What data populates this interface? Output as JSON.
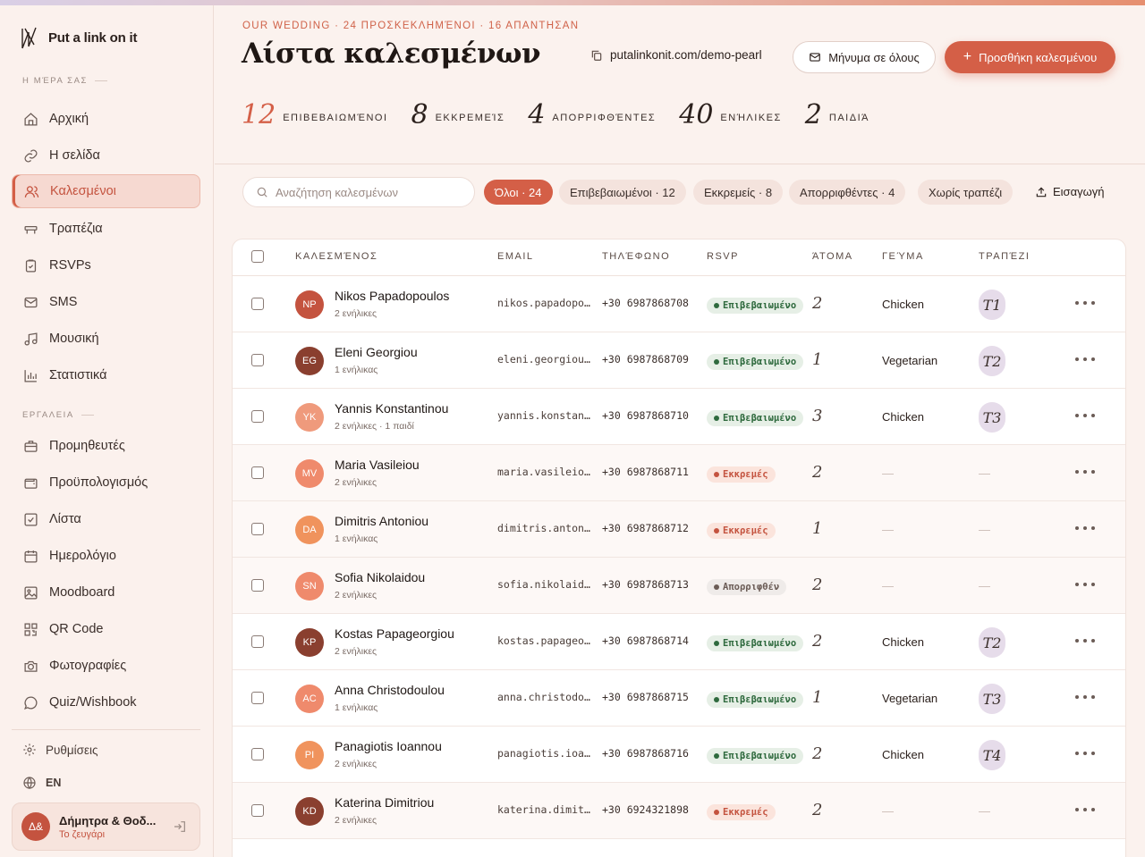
{
  "brand": {
    "name": "Put a link on it"
  },
  "sidebar": {
    "section_day": "Η ΜΈΡΑ ΣΑΣ",
    "section_tools": "ΕΡΓΑΛΕΙΑ",
    "items": [
      {
        "label": "Αρχική",
        "icon": "home-icon"
      },
      {
        "label": "Η σελίδα",
        "icon": "link-icon"
      },
      {
        "label": "Καλεσμένοι",
        "icon": "users-icon"
      },
      {
        "label": "Τραπέζια",
        "icon": "table-icon"
      },
      {
        "label": "RSVPs",
        "icon": "clipboard-icon"
      },
      {
        "label": "SMS",
        "icon": "mail-icon"
      },
      {
        "label": "Μουσική",
        "icon": "music-icon"
      },
      {
        "label": "Στατιστικά",
        "icon": "chart-icon"
      }
    ],
    "tools": [
      {
        "label": "Προμηθευτές",
        "icon": "briefcase-icon"
      },
      {
        "label": "Προϋπολογισμός",
        "icon": "wallet-icon"
      },
      {
        "label": "Λίστα",
        "icon": "checklist-icon"
      },
      {
        "label": "Ημερολόγιο",
        "icon": "calendar-icon"
      },
      {
        "label": "Moodboard",
        "icon": "image-icon"
      },
      {
        "label": "QR Code",
        "icon": "qr-icon"
      },
      {
        "label": "Φωτογραφίες",
        "icon": "camera-icon"
      },
      {
        "label": "Quiz/Wishbook",
        "icon": "chat-icon"
      }
    ],
    "settings_label": "Ρυθμίσεις",
    "language_label": "EN",
    "user": {
      "initials": "Δ&",
      "name": "Δήμητρα & Θοδ...",
      "role": "Το ζευγάρι"
    }
  },
  "header": {
    "kicker": "OUR WEDDING · 24 ΠΡΟΣΚΕΚΛΗΜΈΝΟΙ · 16 ΑΠΑΝΤΗΣΑΝ",
    "title": "Λίστα καλεσμένων",
    "site_link": "putalinkonit.com/demo-pearl",
    "message_all": "Μήνυμα σε όλους",
    "add_guest": "Προσθήκη καλεσμένου"
  },
  "stats": [
    {
      "value": "12",
      "label": "ΕΠΙΒΕΒΑΙΩΜΈΝΟΙ"
    },
    {
      "value": "8",
      "label": "ΕΚΚΡΕΜΕΊΣ"
    },
    {
      "value": "4",
      "label": "ΑΠΟΡΡΙΦΘΈΝΤΕΣ"
    },
    {
      "value": "40",
      "label": "ΕΝΉΛΙΚΕΣ"
    },
    {
      "value": "2",
      "label": "ΠΑΙΔΙΆ"
    }
  ],
  "filters": {
    "search_placeholder": "Αναζήτηση καλεσμένων",
    "chips": [
      "Όλοι · 24",
      "Επιβεβαιωμένοι · 12",
      "Εκκρεμείς · 8",
      "Απορριφθέντες · 4",
      "Χωρίς τραπέζι"
    ],
    "import_label": "Εισαγωγή"
  },
  "table": {
    "columns": [
      "ΚΑΛΕΣΜΈΝΟΣ",
      "EMAIL",
      "ΤΗΛΈΦΩΝΟ",
      "RSVP",
      "ΆΤΟΜΑ",
      "ΓΕΎΜΑ",
      "ΤΡΑΠΈΖΙ"
    ],
    "rows": [
      {
        "initials": "NP",
        "name": "Nikos Papadopoulos",
        "party": "2 ενήλικες",
        "email": "nikos.papadopoulos@",
        "phone": "+30 6987868708",
        "rsvp": "Επιβεβαιωμένο",
        "status": "confirmed",
        "count": "2",
        "meal": "Chicken",
        "table": "T1",
        "avatar_color": "#c4533f"
      },
      {
        "initials": "EG",
        "name": "Eleni Georgiou",
        "party": "1 ενήλικας",
        "email": "eleni.georgiou@mail",
        "phone": "+30 6987868709",
        "rsvp": "Επιβεβαιωμένο",
        "status": "confirmed",
        "count": "1",
        "meal": "Vegetarian",
        "table": "T2",
        "avatar_color": "#8a3f2f"
      },
      {
        "initials": "YK",
        "name": "Yannis Konstantinou",
        "party": "2 ενήλικες · 1 παιδί",
        "email": "yannis.konstantinou@",
        "phone": "+30 6987868710",
        "rsvp": "Επιβεβαιωμένο",
        "status": "confirmed",
        "count": "3",
        "meal": "Chicken",
        "table": "T3",
        "avatar_color": "#ef9a7c"
      },
      {
        "initials": "MV",
        "name": "Maria Vasileiou",
        "party": "2 ενήλικες",
        "email": "maria.vasileiou@mail",
        "phone": "+30 6987868711",
        "rsvp": "Εκκρεμές",
        "status": "pending",
        "count": "2",
        "meal": "—",
        "table": "—",
        "avatar_color": "#ef8a6c"
      },
      {
        "initials": "DA",
        "name": "Dimitris Antoniou",
        "party": "1 ενήλικας",
        "email": "dimitris.antoniou@",
        "phone": "+30 6987868712",
        "rsvp": "Εκκρεμές",
        "status": "pending",
        "count": "1",
        "meal": "—",
        "table": "—",
        "avatar_color": "#f0935d"
      },
      {
        "initials": "SN",
        "name": "Sofia Nikolaidou",
        "party": "2 ενήλικες",
        "email": "sofia.nikolaidou@",
        "phone": "+30 6987868713",
        "rsvp": "Απορριφθέν",
        "status": "declined",
        "count": "2",
        "meal": "—",
        "table": "—",
        "avatar_color": "#ef8a6c"
      },
      {
        "initials": "KP",
        "name": "Kostas Papageorgiou",
        "party": "2 ενήλικες",
        "email": "kostas.papageorgiou@",
        "phone": "+30 6987868714",
        "rsvp": "Επιβεβαιωμένο",
        "status": "confirmed",
        "count": "2",
        "meal": "Chicken",
        "table": "T2",
        "avatar_color": "#8a3f2f"
      },
      {
        "initials": "AC",
        "name": "Anna Christodoulou",
        "party": "1 ενήλικας",
        "email": "anna.christodoulou@",
        "phone": "+30 6987868715",
        "rsvp": "Επιβεβαιωμένο",
        "status": "confirmed",
        "count": "1",
        "meal": "Vegetarian",
        "table": "T3",
        "avatar_color": "#ef8a6c"
      },
      {
        "initials": "PI",
        "name": "Panagiotis Ioannou",
        "party": "2 ενήλικες",
        "email": "panagiotis.ioannou@",
        "phone": "+30 6987868716",
        "rsvp": "Επιβεβαιωμένο",
        "status": "confirmed",
        "count": "2",
        "meal": "Chicken",
        "table": "T4",
        "avatar_color": "#f0935d"
      },
      {
        "initials": "KD",
        "name": "Katerina Dimitriou",
        "party": "2 ενήλικες",
        "email": "katerina.dimitriou@",
        "phone": "+30 6924321898",
        "rsvp": "Εκκρεμές",
        "status": "pending",
        "count": "2",
        "meal": "—",
        "table": "—",
        "avatar_color": "#8a3f2f"
      }
    ]
  },
  "colors": {
    "accent": "#d45f47",
    "confirmed": "#2f6a3e",
    "pending": "#c4533f",
    "declined": "#6b5c56"
  }
}
